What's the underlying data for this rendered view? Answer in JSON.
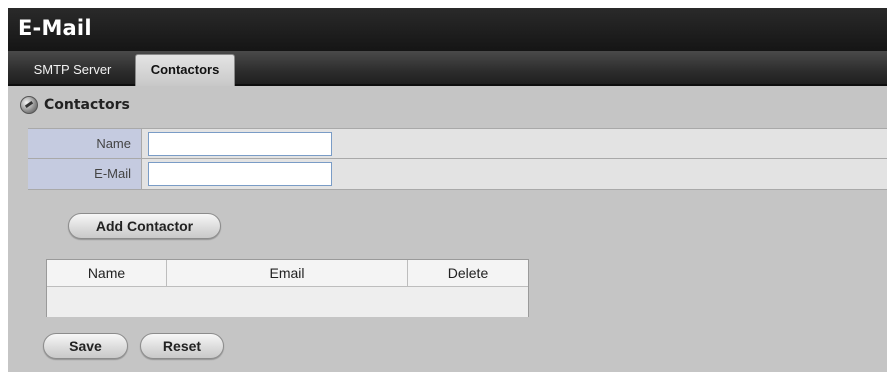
{
  "app": {
    "title": "E-Mail"
  },
  "tabs": [
    {
      "label": "SMTP Server",
      "active": false
    },
    {
      "label": "Contactors",
      "active": true
    }
  ],
  "section": {
    "title": "Contactors",
    "icon": "section-gear-icon"
  },
  "form": {
    "name": {
      "label": "Name",
      "value": "",
      "placeholder": ""
    },
    "email": {
      "label": "E-Mail",
      "value": "",
      "placeholder": ""
    }
  },
  "buttons": {
    "add_contactor": "Add Contactor",
    "save": "Save",
    "reset": "Reset"
  },
  "table": {
    "headers": [
      "Name",
      "Email",
      "Delete"
    ],
    "rows": []
  },
  "colors": {
    "title_bar": "#1a1a1a",
    "panel_bg": "#c5c5c5",
    "label_bg": "#c5cbe0",
    "input_border": "#7a9cc6"
  }
}
